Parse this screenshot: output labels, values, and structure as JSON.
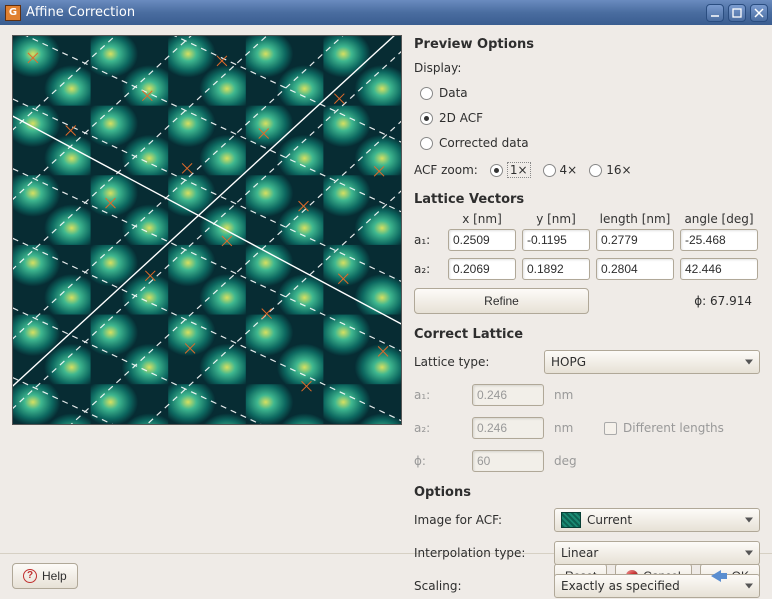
{
  "window": {
    "title": "Affine Correction"
  },
  "preview": {
    "heading": "Preview Options",
    "display_label": "Display:",
    "display": {
      "data": "Data",
      "acf": "2D ACF",
      "corrected": "Corrected data",
      "selected": "acf"
    },
    "zoom_label": "ACF zoom:",
    "zoom": {
      "z1": "1×",
      "z4": "4×",
      "z16": "16×",
      "selected": "z1"
    }
  },
  "lattice": {
    "heading": "Lattice Vectors",
    "cols": {
      "x": "x [nm]",
      "y": "y [nm]",
      "len": "length [nm]",
      "ang": "angle [deg]"
    },
    "a1": {
      "label": "a₁:",
      "x": "0.2509",
      "y": "-0.1195",
      "len": "0.2779",
      "ang": "-25.468"
    },
    "a2": {
      "label": "a₂:",
      "x": "0.2069",
      "y": "0.1892",
      "len": "0.2804",
      "ang": "42.446"
    },
    "refine": "Refine",
    "phi": "ϕ: 67.914"
  },
  "correct": {
    "heading": "Correct Lattice",
    "type_label": "Lattice type:",
    "type_value": "HOPG",
    "a1_label": "a₁:",
    "a1_value": "0.246",
    "a1_unit": "nm",
    "a2_label": "a₂:",
    "a2_value": "0.246",
    "a2_unit": "nm",
    "phi_label": "ϕ:",
    "phi_value": "60",
    "phi_unit": "deg",
    "diff_label": "Different lengths"
  },
  "options": {
    "heading": "Options",
    "image_label": "Image for ACF:",
    "image_value": "Current",
    "interp_label": "Interpolation type:",
    "interp_value": "Linear",
    "scaling_label": "Scaling:",
    "scaling_value": "Exactly as specified"
  },
  "footer": {
    "help": "Help",
    "reset": "Reset",
    "cancel": "Cancel",
    "ok": "OK"
  }
}
